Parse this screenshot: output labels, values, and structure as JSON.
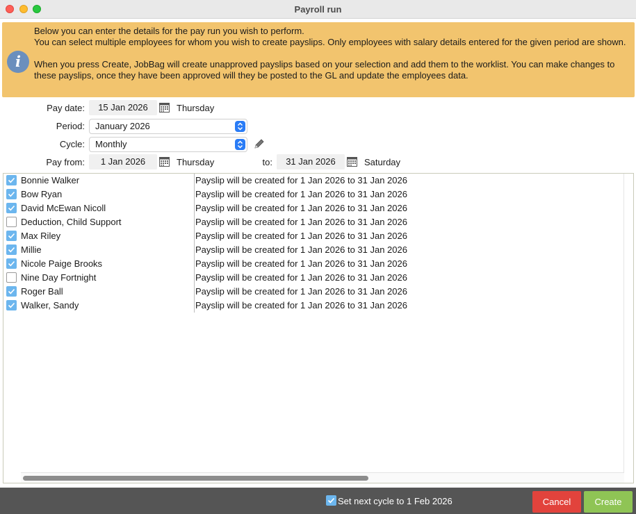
{
  "window": {
    "title": "Payroll run"
  },
  "info": {
    "icon": "info-icon",
    "glyph": "i",
    "paragraphs": [
      "Below you can enter the details for the pay run you wish to perform.",
      "You can select multiple employees for whom you wish to create payslips. Only employees with salary details entered for the given period are shown.",
      "When you press Create, JobBag will create unapproved payslips based on your selection and add them to the worklist. You can make changes to these payslips, once they have been approved will they be posted to the GL and update the employees data."
    ]
  },
  "form": {
    "pay_date": {
      "label": "Pay date:",
      "value": "15 Jan 2026",
      "day": "Thursday"
    },
    "period": {
      "label": "Period:",
      "value": "January 2026"
    },
    "cycle": {
      "label": "Cycle:",
      "value": "Monthly"
    },
    "pay_from": {
      "label": "Pay from:",
      "value": "1 Jan 2026",
      "day": "Thursday"
    },
    "pay_to": {
      "label": "to:",
      "value": "31 Jan 2026",
      "day": "Saturday"
    }
  },
  "employees": [
    {
      "name": "Bonnie Walker",
      "checked": true,
      "status": "Payslip will be created for 1 Jan 2026 to 31 Jan 2026"
    },
    {
      "name": "Bow Ryan",
      "checked": true,
      "status": "Payslip will be created for 1 Jan 2026 to 31 Jan 2026"
    },
    {
      "name": "David McEwan Nicoll",
      "checked": true,
      "status": "Payslip will be created for 1 Jan 2026 to 31 Jan 2026"
    },
    {
      "name": "Deduction, Child Support",
      "checked": false,
      "status": "Payslip will be created for 1 Jan 2026 to 31 Jan 2026"
    },
    {
      "name": "Max Riley",
      "checked": true,
      "status": "Payslip will be created for 1 Jan 2026 to 31 Jan 2026"
    },
    {
      "name": "Millie",
      "checked": true,
      "status": "Payslip will be created for 1 Jan 2026 to 31 Jan 2026"
    },
    {
      "name": "Nicole Paige Brooks",
      "checked": true,
      "status": "Payslip will be created for 1 Jan 2026 to 31 Jan 2026"
    },
    {
      "name": "Nine Day Fortnight",
      "checked": false,
      "status": "Payslip will be created for 1 Jan 2026 to 31 Jan 2026"
    },
    {
      "name": "Roger Ball",
      "checked": true,
      "status": "Payslip will be created for 1 Jan 2026 to 31 Jan 2026"
    },
    {
      "name": "Walker, Sandy",
      "checked": true,
      "status": "Payslip will be created for 1 Jan 2026 to 31 Jan 2026"
    }
  ],
  "footer": {
    "next_cycle_checked": true,
    "next_cycle_label": "Set next cycle to 1 Feb 2026",
    "cancel_label": "Cancel",
    "create_label": "Create"
  },
  "colors": {
    "info_banner": "#f2c46e",
    "info_icon": "#6b8fbd",
    "select_accent": "#2a7cf6",
    "checkbox_on": "#6cb6ee",
    "cancel": "#e2433c",
    "create": "#8fc455",
    "footer_bg": "#555555"
  }
}
